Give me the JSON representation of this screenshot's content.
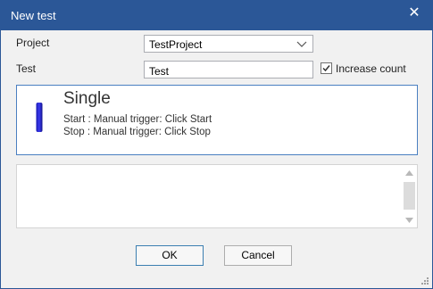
{
  "window": {
    "title": "New test",
    "close_symbol": "✕",
    "title_bar_color": "#2b5797"
  },
  "form": {
    "project_label": "Project",
    "project_value": "TestProject",
    "test_label": "Test",
    "test_value": "Test",
    "increase_count_label": "Increase count",
    "increase_count_checked": true
  },
  "test_card": {
    "icon": "blue-bar-icon",
    "title": "Single",
    "start_line": "Start : Manual trigger: Click Start",
    "stop_line": "Stop : Manual trigger: Click Stop",
    "accent_color": "#4a7fc1"
  },
  "buttons": {
    "ok_label": "OK",
    "cancel_label": "Cancel"
  },
  "icons": {
    "dropdown": "chevron-down-icon",
    "checkbox": "checkmark-icon",
    "scroll_up": "scroll-up-arrow-icon",
    "scroll_down": "scroll-down-arrow-icon",
    "resize": "resize-grip-icon"
  }
}
